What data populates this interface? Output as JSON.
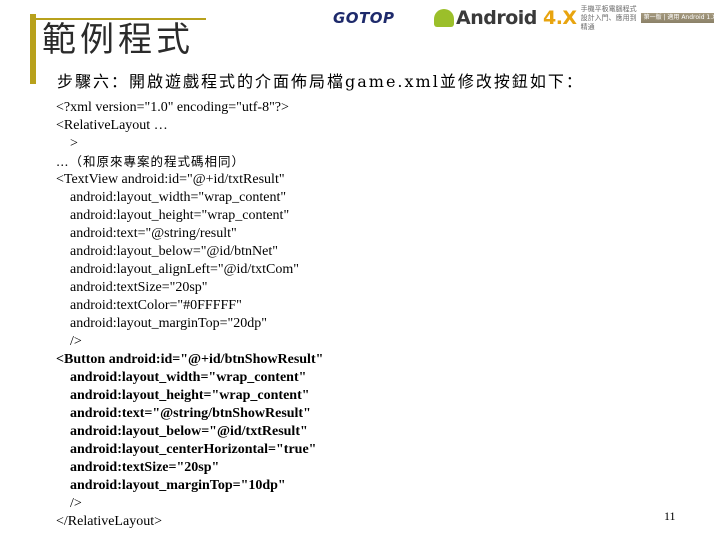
{
  "slide": {
    "title": "範例程式",
    "publisher_logo": "GOTOP",
    "banner": {
      "title_main": "Android ",
      "title_version": "4.X",
      "subtitle": "手機平板電腦程式設計入門、應用到精通",
      "strip": "第一版 | 適用 Android 1.X～4.X"
    },
    "step_heading": "步驟六：開啟遊戲程式的介面佈局檔game.xml並修改按鈕如下：",
    "code_lines": [
      {
        "text": "<?xml version=\"1.0\" encoding=\"utf-8\"?>",
        "indent": false,
        "bold": false
      },
      {
        "text": "<RelativeLayout …",
        "indent": false,
        "bold": false
      },
      {
        "text": ">",
        "indent": true,
        "bold": false
      },
      {
        "text": "…（和原來專案的程式碼相同）",
        "indent": false,
        "bold": false,
        "cjk": true
      },
      {
        "text": "<TextView android:id=\"@+id/txtResult\"",
        "indent": false,
        "bold": false
      },
      {
        "text": "android:layout_width=\"wrap_content\"",
        "indent": true,
        "bold": false
      },
      {
        "text": "android:layout_height=\"wrap_content\"",
        "indent": true,
        "bold": false
      },
      {
        "text": "android:text=\"@string/result\"",
        "indent": true,
        "bold": false
      },
      {
        "text": "android:layout_below=\"@id/btnNet\"",
        "indent": true,
        "bold": false
      },
      {
        "text": "android:layout_alignLeft=\"@id/txtCom\"",
        "indent": true,
        "bold": false
      },
      {
        "text": "android:textSize=\"20sp\"",
        "indent": true,
        "bold": false
      },
      {
        "text": "android:textColor=\"#0FFFFF\"",
        "indent": true,
        "bold": false
      },
      {
        "text": "android:layout_marginTop=\"20dp\"",
        "indent": true,
        "bold": false
      },
      {
        "text": "/>",
        "indent": true,
        "bold": false
      },
      {
        "text": "<Button android:id=\"@+id/btnShowResult\"",
        "indent": false,
        "bold": true
      },
      {
        "text": "android:layout_width=\"wrap_content\"",
        "indent": true,
        "bold": true
      },
      {
        "text": "android:layout_height=\"wrap_content\"",
        "indent": true,
        "bold": true
      },
      {
        "text": "android:text=\"@string/btnShowResult\"",
        "indent": true,
        "bold": true
      },
      {
        "text": "android:layout_below=\"@id/txtResult\"",
        "indent": true,
        "bold": true
      },
      {
        "text": "android:layout_centerHorizontal=\"true\"",
        "indent": true,
        "bold": true
      },
      {
        "text": "android:textSize=\"20sp\"",
        "indent": true,
        "bold": true
      },
      {
        "text": "android:layout_marginTop=\"10dp\"",
        "indent": true,
        "bold": true
      },
      {
        "text": "/>",
        "indent": true,
        "bold": false
      },
      {
        "text": "</RelativeLayout>",
        "indent": false,
        "bold": false
      }
    ],
    "page_number": "11"
  },
  "colors": {
    "accent": "#b8a11c",
    "logo": "#1e2a6b",
    "version": "#e8a40f"
  }
}
